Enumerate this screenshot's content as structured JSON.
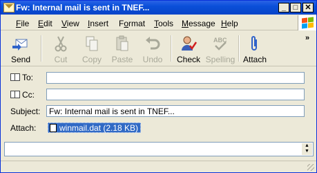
{
  "window": {
    "title": "Fw: Internal mail is sent in TNEF..."
  },
  "menu": [
    {
      "label_u": "F",
      "label_rest": "ile"
    },
    {
      "label_u": "E",
      "label_rest": "dit"
    },
    {
      "label_u": "V",
      "label_rest": "iew"
    },
    {
      "label_u": "I",
      "label_rest": "nsert"
    },
    {
      "label_pre": "F",
      "label_u": "o",
      "label_rest": "rmat"
    },
    {
      "label_u": "T",
      "label_rest": "ools"
    },
    {
      "label_u": "M",
      "label_rest": "essage"
    },
    {
      "label_u": "H",
      "label_rest": "elp"
    }
  ],
  "toolbar": {
    "send": "Send",
    "cut": "Cut",
    "copy": "Copy",
    "paste": "Paste",
    "undo": "Undo",
    "check": "Check",
    "spelling": "Spelling",
    "attach": "Attach",
    "more": "»"
  },
  "fields": {
    "to_label": "To:",
    "cc_label": "Cc:",
    "subject_label": "Subject:",
    "subject_value": "Fw: Internal mail is sent in TNEF...",
    "attach_label": "Attach:",
    "attachment": "winmail.dat (2.18 KB)"
  },
  "colors": {
    "title_blue": "#0a4fd9",
    "selection": "#316ac5"
  }
}
